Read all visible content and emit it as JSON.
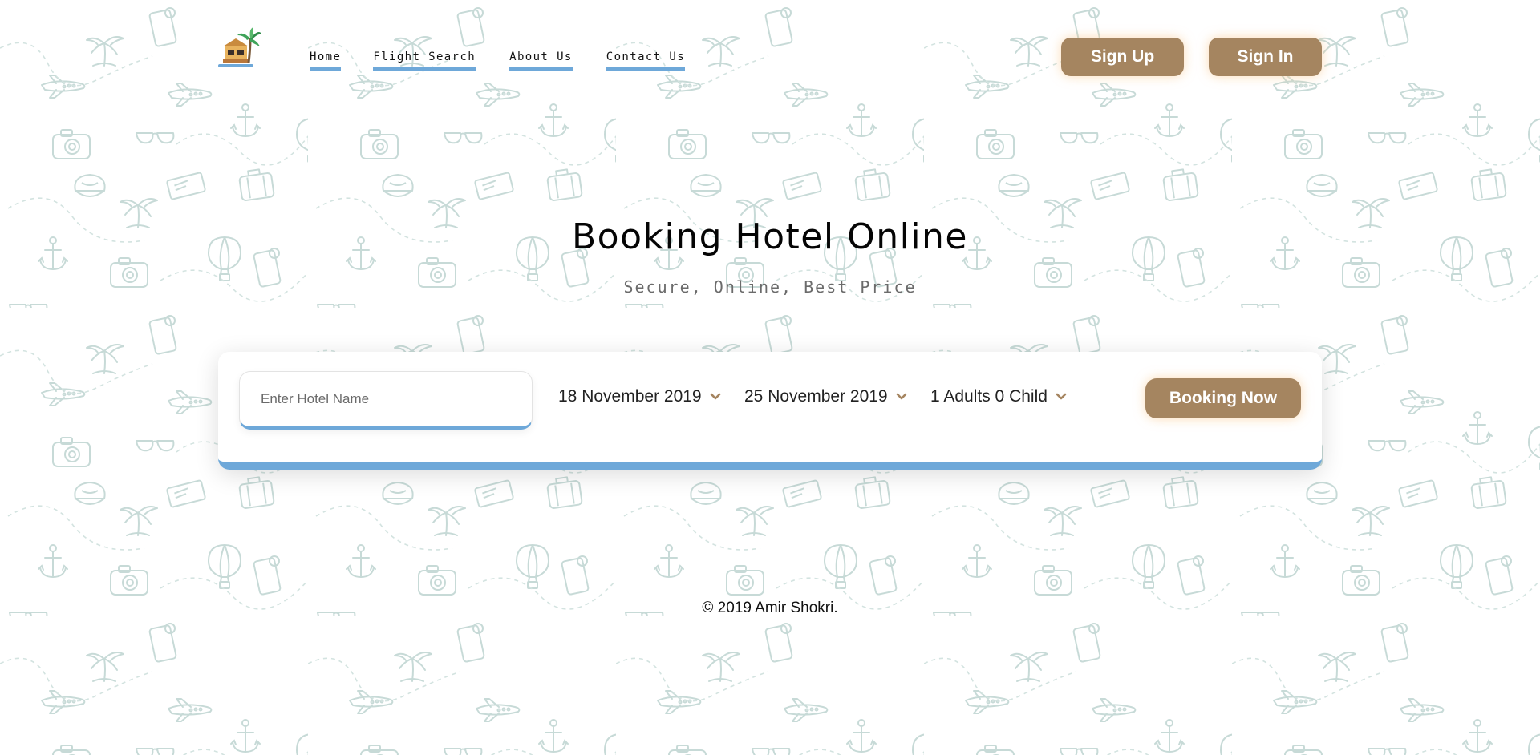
{
  "nav": {
    "items": [
      {
        "label": "Home"
      },
      {
        "label": "Flight Search"
      },
      {
        "label": "About Us"
      },
      {
        "label": "Contact Us"
      }
    ]
  },
  "auth": {
    "signup_label": "Sign Up",
    "signin_label": "Sign In"
  },
  "hero": {
    "title": "Booking Hotel Online",
    "subtitle": "Secure, Online, Best Price"
  },
  "search": {
    "hotel_placeholder": "Enter Hotel Name",
    "hotel_value": "",
    "checkin": "18 November 2019",
    "checkout": "25 November 2019",
    "guests": "1 Adults 0 Child",
    "submit_label": "Booking Now"
  },
  "footer": {
    "copyright": "© 2019 Amir Shokri."
  },
  "colors": {
    "accent_brown": "#a58560",
    "accent_blue": "#6ea8d9",
    "pattern": "#c9dcd9"
  },
  "icons": {
    "logo": "beach-hut-palm-icon",
    "dropdown": "chevron-down-icon"
  }
}
